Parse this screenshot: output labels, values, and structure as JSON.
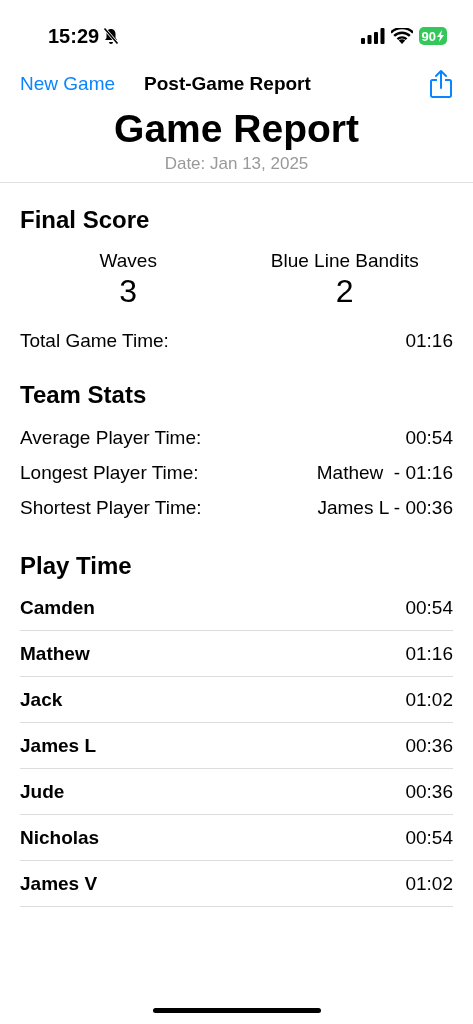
{
  "status_bar": {
    "time": "15:29",
    "battery": "90"
  },
  "nav": {
    "back": "New Game",
    "title": "Post-Game Report"
  },
  "header": {
    "title": "Game Report",
    "date": "Date: Jan 13, 2025"
  },
  "final_score": {
    "heading": "Final Score",
    "teams": [
      {
        "name": "Waves",
        "score": "3"
      },
      {
        "name": "Blue Line Bandits",
        "score": "2"
      }
    ],
    "total_label": "Total Game Time:",
    "total_value": "01:16"
  },
  "team_stats": {
    "heading": "Team Stats",
    "rows": [
      {
        "label": "Average Player Time:",
        "value": "00:54"
      },
      {
        "label": "Longest Player Time:",
        "value": "Mathew  - 01:16"
      },
      {
        "label": "Shortest Player Time:",
        "value": "James L - 00:36"
      }
    ]
  },
  "play_time": {
    "heading": "Play Time",
    "players": [
      {
        "name": "Camden",
        "time": "00:54"
      },
      {
        "name": "Mathew",
        "time": "01:16"
      },
      {
        "name": "Jack",
        "time": "01:02"
      },
      {
        "name": "James L",
        "time": "00:36"
      },
      {
        "name": "Jude",
        "time": "00:36"
      },
      {
        "name": "Nicholas",
        "time": "00:54"
      },
      {
        "name": "James V",
        "time": "01:02"
      }
    ]
  }
}
